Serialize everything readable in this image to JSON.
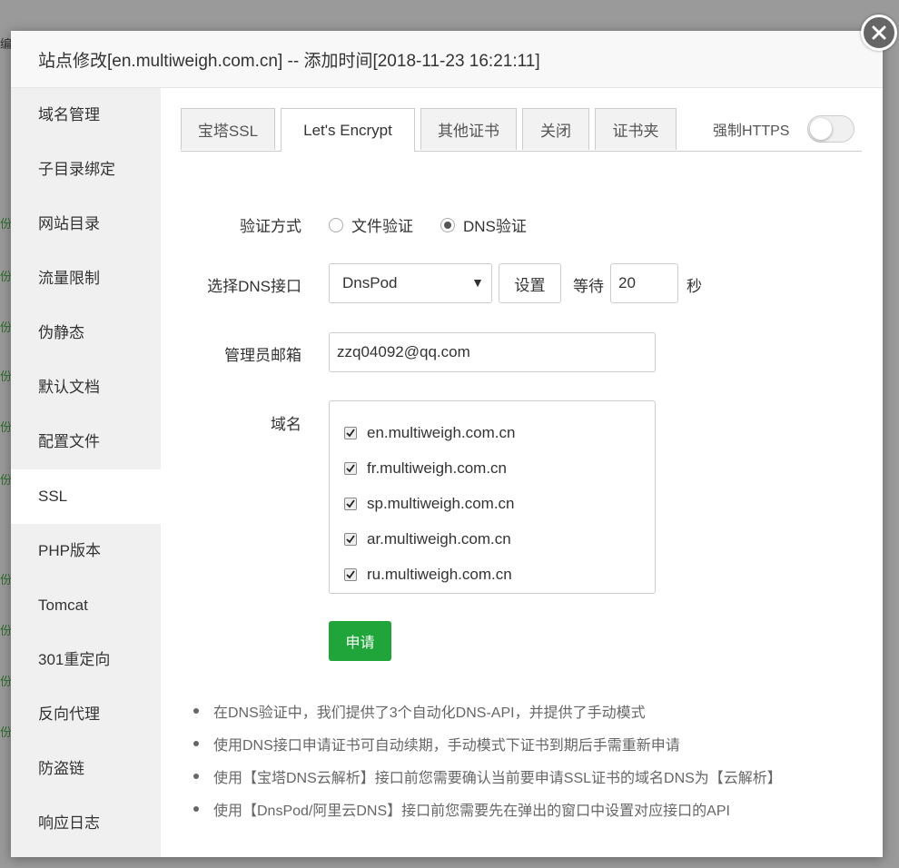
{
  "background": {
    "fragments": [
      "份",
      "份",
      "份",
      "份",
      "份",
      "份",
      "份",
      "份",
      "份",
      "份"
    ],
    "header_fragment": "编"
  },
  "modal": {
    "title": "站点修改[en.multiweigh.com.cn] -- 添加时间[2018-11-23 16:21:11]"
  },
  "sidebar": {
    "items": [
      {
        "label": "域名管理"
      },
      {
        "label": "子目录绑定"
      },
      {
        "label": "网站目录"
      },
      {
        "label": "流量限制"
      },
      {
        "label": "伪静态"
      },
      {
        "label": "默认文档"
      },
      {
        "label": "配置文件"
      },
      {
        "label": "SSL"
      },
      {
        "label": "PHP版本"
      },
      {
        "label": "Tomcat"
      },
      {
        "label": "301重定向"
      },
      {
        "label": "反向代理"
      },
      {
        "label": "防盗链"
      },
      {
        "label": "响应日志"
      }
    ],
    "active_index": 7
  },
  "tabs": [
    {
      "label": "宝塔SSL"
    },
    {
      "label": "Let's Encrypt"
    },
    {
      "label": "其他证书"
    },
    {
      "label": "关闭"
    },
    {
      "label": "证书夹"
    }
  ],
  "force_https": {
    "label": "强制HTTPS",
    "enabled": false
  },
  "form": {
    "verify_label": "验证方式",
    "verify_options": [
      {
        "label": "文件验证",
        "checked": false
      },
      {
        "label": "DNS验证",
        "checked": true
      }
    ],
    "dns_label": "选择DNS接口",
    "dns_selected": "DnsPod",
    "settings_button": "设置",
    "wait_label": "等待",
    "wait_value": "20",
    "seconds_label": "秒",
    "email_label": "管理员邮箱",
    "email_value": "zzq04092@qq.com",
    "domain_label": "域名",
    "domains": [
      {
        "name": "en.multiweigh.com.cn",
        "checked": true
      },
      {
        "name": "fr.multiweigh.com.cn",
        "checked": true
      },
      {
        "name": "sp.multiweigh.com.cn",
        "checked": true
      },
      {
        "name": "ar.multiweigh.com.cn",
        "checked": true
      },
      {
        "name": "ru.multiweigh.com.cn",
        "checked": true
      }
    ],
    "apply_button": "申请"
  },
  "tips": [
    "在DNS验证中，我们提供了3个自动化DNS-API，并提供了手动模式",
    "使用DNS接口申请证书可自动续期，手动模式下证书到期后手需重新申请",
    "使用【宝塔DNS云解析】接口前您需要确认当前要申请SSL证书的域名DNS为【云解析】",
    "使用【DnsPod/阿里云DNS】接口前您需要先在弹出的窗口中设置对应接口的API"
  ],
  "colors": {
    "primary": "#20a53a",
    "sidebar_bg": "#f0f0f0"
  }
}
